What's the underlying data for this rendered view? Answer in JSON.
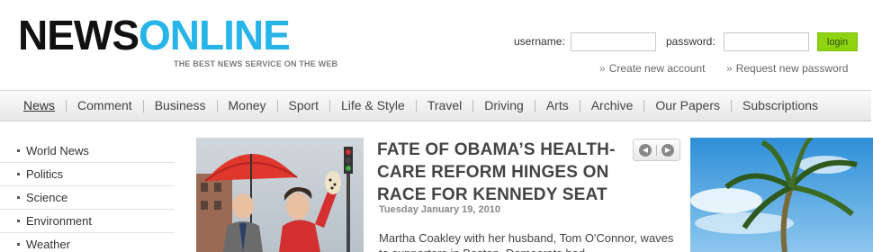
{
  "logo": {
    "part1": "NEWS",
    "part2": "ONLINE",
    "tagline": "THE BEST NEWS SERVICE ON THE WEB"
  },
  "login": {
    "username_label": "username:",
    "password_label": "password:",
    "username_value": "",
    "password_value": "",
    "button": "login",
    "create_account": "Create new account",
    "request_password": "Request new password",
    "link_arrow": "»"
  },
  "nav": {
    "items": [
      "News",
      "Comment",
      "Business",
      "Money",
      "Sport",
      "Life & Style",
      "Travel",
      "Driving",
      "Arts",
      "Archive",
      "Our Papers",
      "Subscriptions"
    ],
    "active": "News"
  },
  "sidebar": {
    "items": [
      "World News",
      "Politics",
      "Science",
      "Environment",
      "Weather"
    ]
  },
  "feature": {
    "headline": "FATE OF OBAMA’S HEALTH-CARE REFORM HINGES ON RACE FOR KENNEDY SEAT",
    "date": "Tuesday January 19, 2010",
    "text": "Martha Coakley with her husband, Tom O'Connor, waves to supporters in Boston. Democrats had",
    "pager_prev": "◀",
    "pager_next": "▶"
  },
  "colors": {
    "accent": "#27b4e8",
    "login_button": "#8fd412"
  }
}
